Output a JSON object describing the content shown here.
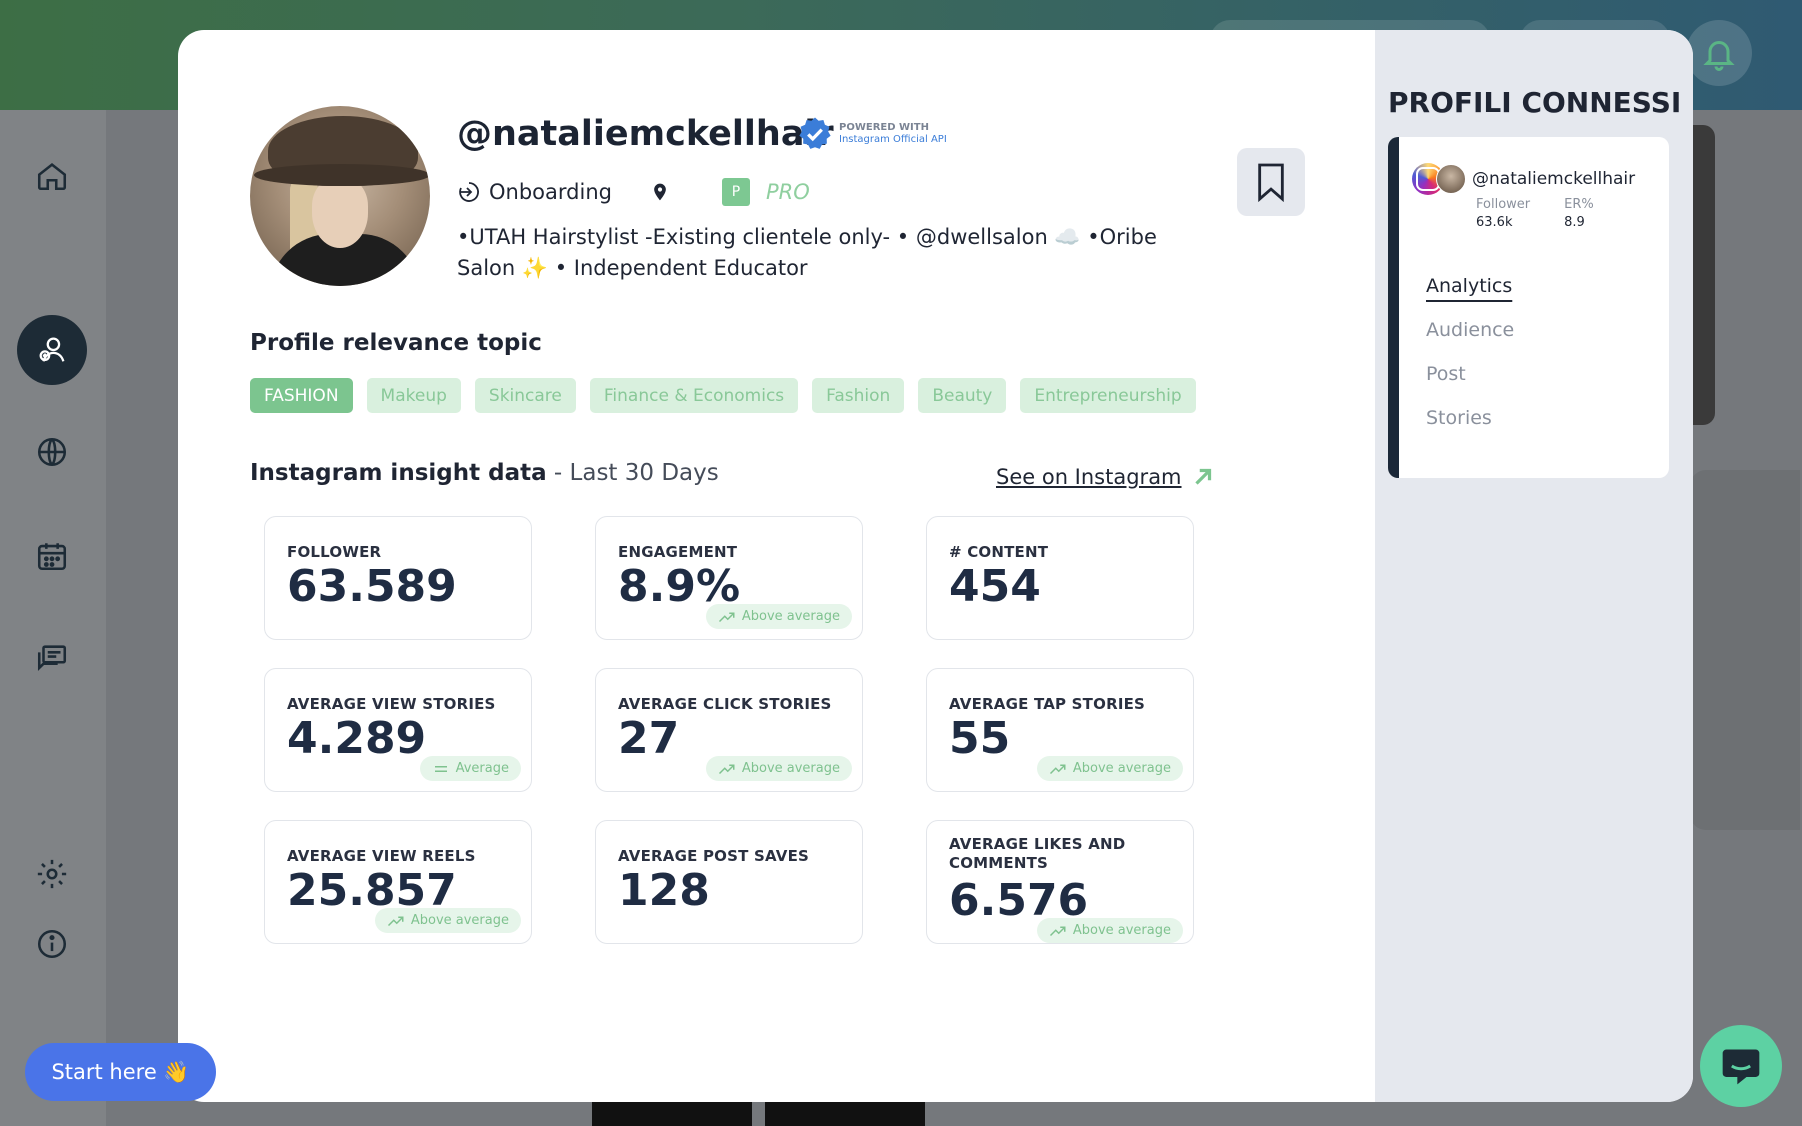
{
  "profile": {
    "username": "@nataliemckellhair",
    "verified_line1": "POWERED WITH",
    "verified_line2": "Instagram Official API",
    "status": "Onboarding",
    "p_badge": "P",
    "plan": "PRO",
    "bio_line1": "•UTAH Hairstylist -Existing clientele only- • @dwellsalon ☁️ •Oribe",
    "bio_line2": "Salon ✨ • Independent Educator"
  },
  "topics": {
    "title": "Profile relevance topic",
    "tags": [
      "FASHION",
      "Makeup",
      "Skincare",
      "Finance & Economics",
      "Fashion",
      "Beauty",
      "Entrepreneurship"
    ]
  },
  "insights": {
    "title": "Instagram insight data",
    "period": " - Last 30 Days",
    "see_link": "See on Instagram",
    "cards": [
      {
        "label": "FOLLOWER",
        "value": "63.589",
        "badge": ""
      },
      {
        "label": "ENGAGEMENT",
        "value": "8.9%",
        "badge": "Above average"
      },
      {
        "label": "# CONTENT",
        "value": "454",
        "badge": ""
      },
      {
        "label": "AVERAGE VIEW STORIES",
        "value": "4.289",
        "badge": "Average"
      },
      {
        "label": "AVERAGE CLICK STORIES",
        "value": "27",
        "badge": "Above average"
      },
      {
        "label": "AVERAGE TAP STORIES",
        "value": "55",
        "badge": "Above average"
      },
      {
        "label": "AVERAGE VIEW REELS",
        "value": "25.857",
        "badge": "Above average"
      },
      {
        "label": "AVERAGE POST SAVES",
        "value": "128",
        "badge": ""
      },
      {
        "label": "AVERAGE LIKES AND COMMENTS",
        "value": "6.576",
        "badge": "Above average"
      }
    ]
  },
  "side": {
    "title": "PROFILI CONNESSI",
    "account": {
      "name": "@nataliemckellhair",
      "follower_label": "Follower",
      "follower_value": "63.6k",
      "er_label": "ER%",
      "er_value": "8.9"
    },
    "nav": [
      "Analytics",
      "Audience",
      "Post",
      "Stories"
    ]
  },
  "start_here": "Start here 👋",
  "colors": {
    "accent_green": "#7cc58f",
    "tag_bg": "#d9f0de",
    "cta_blue": "#4a74e8",
    "chat_green": "#5dd1a3"
  }
}
